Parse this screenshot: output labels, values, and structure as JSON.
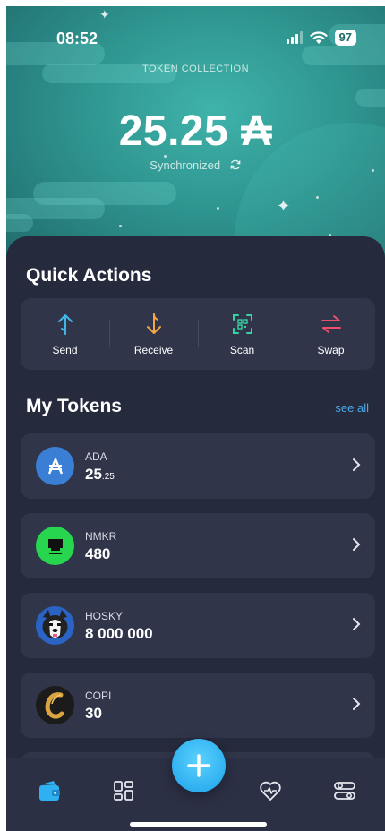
{
  "status_bar": {
    "time": "08:52",
    "battery": "97"
  },
  "header": {
    "collection_label": "TOKEN COLLECTION",
    "balance": "25.25 ₳",
    "sync_status": "Synchronized"
  },
  "quick_actions": {
    "title": "Quick Actions",
    "items": [
      {
        "label": "Send",
        "icon": "arrow-up-icon",
        "color": "#3fb8e8"
      },
      {
        "label": "Receive",
        "icon": "arrow-down-icon",
        "color": "#f2a646"
      },
      {
        "label": "Scan",
        "icon": "qr-scan-icon",
        "color": "#3ad1a1"
      },
      {
        "label": "Swap",
        "icon": "swap-icon",
        "color": "#ee4f6a"
      }
    ]
  },
  "my_tokens": {
    "title": "My Tokens",
    "see_all": "see all",
    "tokens": [
      {
        "name": "ADA",
        "amount_main": "25",
        "amount_frac": ".25",
        "icon": "ada-logo-icon",
        "color": "#3a7fd5"
      },
      {
        "name": "NMKR",
        "amount_main": "480",
        "amount_frac": "",
        "icon": "nmkr-logo-icon",
        "color": "#27d54f"
      },
      {
        "name": "HOSKY",
        "amount_main": "8 000 000",
        "amount_frac": "",
        "icon": "hosky-logo-icon",
        "color": "#2a63c4"
      },
      {
        "name": "COPI",
        "amount_main": "30",
        "amount_frac": "",
        "icon": "copi-logo-icon",
        "color": "#1b1b1b"
      }
    ]
  },
  "nav": {
    "items": [
      "wallet-icon",
      "grid-icon",
      "add-icon",
      "heart-pulse-icon",
      "settings-toggle-icon"
    ],
    "active": "wallet-icon",
    "accent": "#2fb0f0"
  }
}
